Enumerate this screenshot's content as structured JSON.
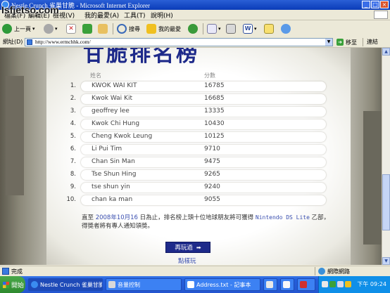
{
  "window": {
    "title": "Nestle Crunch 雀巢甘脆 - Microsoft Internet Explorer",
    "min": "_",
    "max": "□",
    "close": "×"
  },
  "watermark": "Isfjetso.com",
  "menu": [
    "檔案(F)",
    "編輯(E)",
    "檢視(V)",
    "我的最愛(A)",
    "工具(T)",
    "說明(H)"
  ],
  "toolbar": {
    "back": "上一頁",
    "search": "搜尋",
    "favorites": "我的最愛"
  },
  "address": {
    "label": "網址(D)",
    "url": "http://www.ermchhk.com/",
    "go": "移至",
    "links": "連結"
  },
  "leaderboard": {
    "title": "甘脆排名榜",
    "name_header": "姓名",
    "score_header": "分數",
    "entries": [
      {
        "rank": "1.",
        "name": "KWOK WAI KIT",
        "score": "16785"
      },
      {
        "rank": "2.",
        "name": "Kwok Wai Kit",
        "score": "16685"
      },
      {
        "rank": "3.",
        "name": "geoffrey lee",
        "score": "13335"
      },
      {
        "rank": "4.",
        "name": "Kwok Chi Hung",
        "score": "10430"
      },
      {
        "rank": "5.",
        "name": "Cheng Kwok Leung",
        "score": "10125"
      },
      {
        "rank": "6.",
        "name": "Li Pui Tim",
        "score": "9710"
      },
      {
        "rank": "7.",
        "name": "Chan Sin Man",
        "score": "9475"
      },
      {
        "rank": "8.",
        "name": "Tse Shun Hing",
        "score": "9265"
      },
      {
        "rank": "9.",
        "name": "tse shun yin",
        "score": "9240"
      },
      {
        "rank": "10.",
        "name": "chan ka man",
        "score": "9055"
      }
    ],
    "note_part1": "直至 ",
    "note_date": "2008年10月16",
    "note_part2": " 日為止，排名榜上頭十位地球朋友將可獲得 ",
    "note_prize": "Nintendo DS Lite",
    "note_part3": " 乙部，得獎者將有專人通知領獎。",
    "replay": "再玩過",
    "replay_arrow": "➡",
    "how_to": "點樣玩"
  },
  "status": {
    "text": "完成",
    "zone": "網際網路"
  },
  "taskbar": {
    "start": "開始",
    "tasks": [
      "Nestle Crunch 雀巢甘脆...",
      "音量控制",
      "Address.txt - 記事本"
    ],
    "clock": "下午 09:24"
  }
}
